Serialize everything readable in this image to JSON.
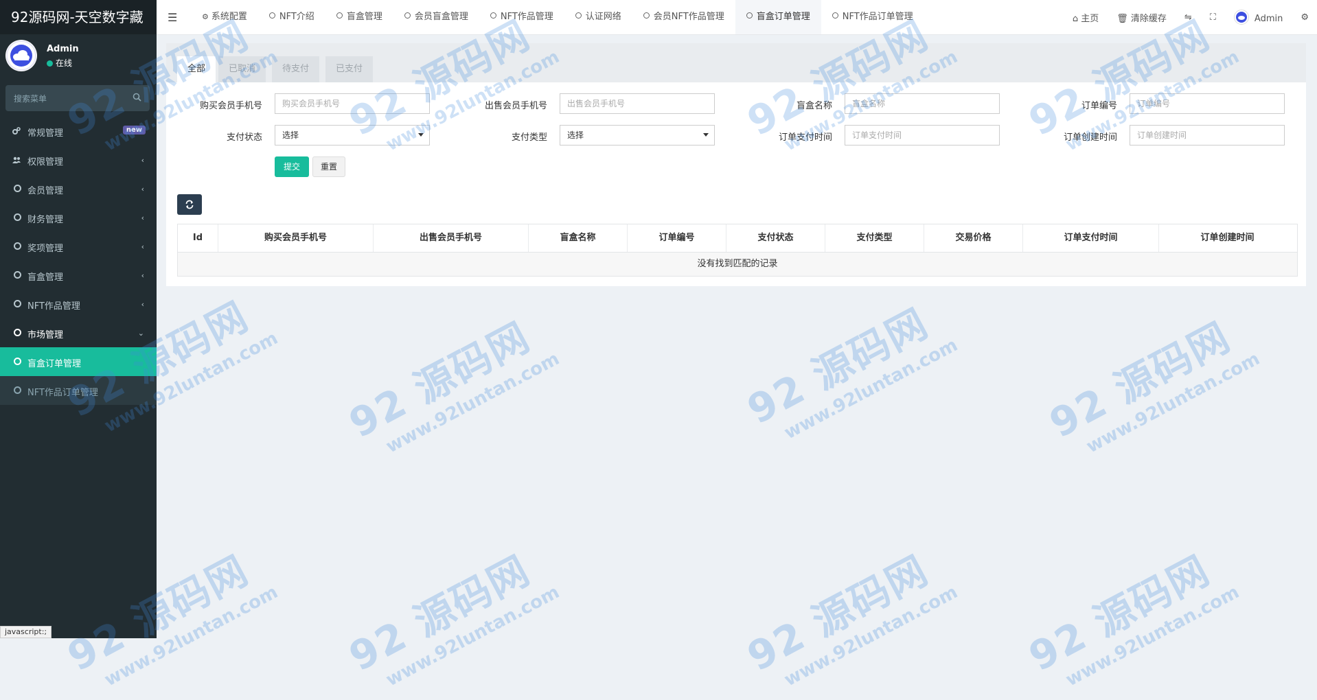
{
  "app": {
    "title": "92源码网-天空数字藏"
  },
  "user": {
    "name": "Admin",
    "status": "在线"
  },
  "sidebar": {
    "search_placeholder": "搜索菜单",
    "badge": "new",
    "items": [
      {
        "label": "常规管理",
        "icon": "cogs-icon"
      },
      {
        "label": "权限管理",
        "icon": "users-icon"
      },
      {
        "label": "会员管理",
        "icon": "circle-icon"
      },
      {
        "label": "财务管理",
        "icon": "circle-icon"
      },
      {
        "label": "奖项管理",
        "icon": "circle-icon"
      },
      {
        "label": "盲盒管理",
        "icon": "circle-icon"
      },
      {
        "label": "NFT作品管理",
        "icon": "circle-icon"
      },
      {
        "label": "市场管理",
        "icon": "circle-icon"
      },
      {
        "label": "盲盒订单管理",
        "icon": "circle-icon"
      },
      {
        "label": "NFT作品订单管理",
        "icon": "circle-icon"
      }
    ]
  },
  "topbar": {
    "tabs": [
      "系统配置",
      "NFT介绍",
      "盲盒管理",
      "会员盲盒管理",
      "NFT作品管理",
      "认证网络",
      "会员NFT作品管理",
      "盲盒订单管理",
      "NFT作品订单管理"
    ],
    "home": "主页",
    "clear_cache": "清除缓存",
    "admin": "Admin"
  },
  "panel": {
    "status_tabs": [
      "全部",
      "已取消",
      "待支付",
      "已支付"
    ],
    "form": {
      "buyer_phone": {
        "label": "购买会员手机号",
        "placeholder": "购买会员手机号"
      },
      "seller_phone": {
        "label": "出售会员手机号",
        "placeholder": "出售会员手机号"
      },
      "box_name": {
        "label": "盲盒名称",
        "placeholder": "盲盒名称"
      },
      "order_no": {
        "label": "订单编号",
        "placeholder": "订单编号"
      },
      "pay_status": {
        "label": "支付状态",
        "value": "选择"
      },
      "pay_type": {
        "label": "支付类型",
        "value": "选择"
      },
      "pay_time": {
        "label": "订单支付时间",
        "placeholder": "订单支付时间"
      },
      "create_time": {
        "label": "订单创建时间",
        "placeholder": "订单创建时间"
      }
    },
    "submit": "提交",
    "reset": "重置",
    "table": {
      "columns": [
        "Id",
        "购买会员手机号",
        "出售会员手机号",
        "盲盒名称",
        "订单编号",
        "支付状态",
        "支付类型",
        "交易价格",
        "订单支付时间",
        "订单创建时间"
      ],
      "empty": "没有找到匹配的记录"
    }
  },
  "watermark": {
    "brand": "92 源码网",
    "url": "www.92luntan.com"
  },
  "status_bar": "javascript:;",
  "colors": {
    "accent": "#18bc9c",
    "sidebar_bg": "#222d32",
    "badge": "#605ca8",
    "refresh_btn": "#2c3e50"
  }
}
